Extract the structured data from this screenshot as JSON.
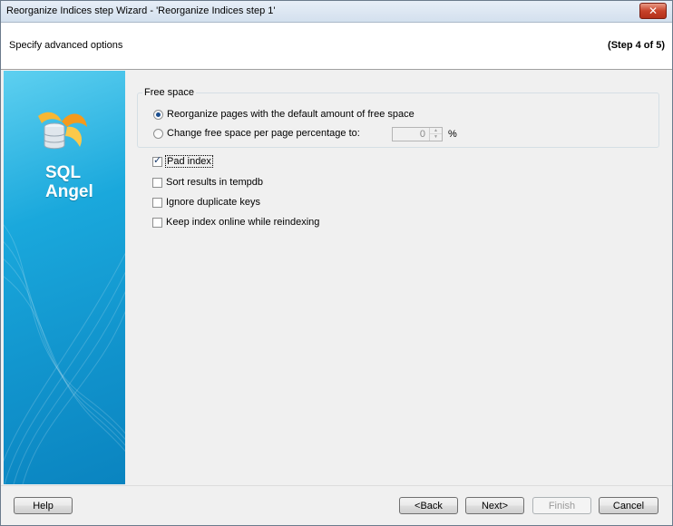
{
  "window": {
    "title": "Reorganize Indices step Wizard - 'Reorganize Indices step 1'",
    "close_glyph": "✕"
  },
  "header": {
    "subtitle": "Specify advanced options",
    "step": "(Step 4 of 5)"
  },
  "sidebar": {
    "logo_line1": "SQL",
    "logo_line2": "Angel",
    "icon": "sql-angel-logo-icon"
  },
  "free_space": {
    "legend": "Free space",
    "option_default": "Reorganize pages with the default amount of free space",
    "option_change": "Change free space per page percentage to:",
    "selected": "default",
    "percentage_value": "0",
    "percent_unit": "%"
  },
  "options": {
    "pad_index": {
      "label": "Pad index",
      "checked": true
    },
    "sort_tempdb": {
      "label": "Sort results in tempdb",
      "checked": false
    },
    "ignore_dup": {
      "label": "Ignore duplicate keys",
      "checked": false
    },
    "keep_online": {
      "label": "Keep index online while reindexing",
      "checked": false
    }
  },
  "buttons": {
    "help": "Help",
    "back": "<Back",
    "next": "Next>",
    "finish": "Finish",
    "cancel": "Cancel"
  },
  "colors": {
    "sidebar_accent": "#1aa8dc",
    "close_button": "#c7422a"
  }
}
